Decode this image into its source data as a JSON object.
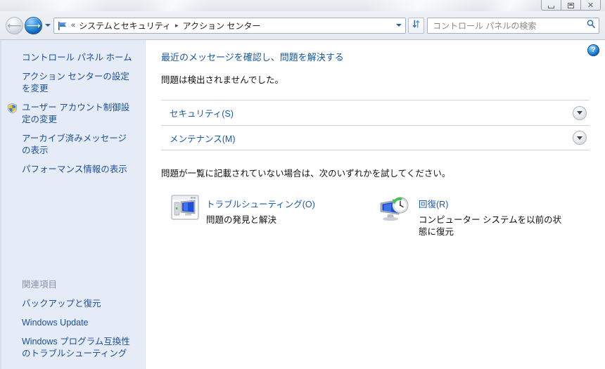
{
  "window": {
    "controls": {
      "minimize_label": "Minimize",
      "maximize_label": "Maximize",
      "close_label": "Close"
    }
  },
  "navbar": {
    "back_label": "戻る",
    "forward_label": "進む",
    "recent_pages_label": "最近表示したページ",
    "address": {
      "chevrons": "«",
      "breadcrumbs": [
        "システムとセキュリティ",
        "アクション センター"
      ],
      "separator": "▸"
    },
    "refresh_label": "最新の情報に更新",
    "search": {
      "placeholder": "コントロール パネルの検索",
      "value": ""
    }
  },
  "sidebar": {
    "items": [
      {
        "label": "コントロール パネル ホーム",
        "icon": ""
      },
      {
        "label": "アクション センターの設定を変更",
        "icon": ""
      },
      {
        "label": "ユーザー アカウント制御設定の変更",
        "icon": "shield-icon"
      },
      {
        "label": "アーカイブ済みメッセージの表示",
        "icon": ""
      },
      {
        "label": "パフォーマンス情報の表示",
        "icon": ""
      }
    ],
    "related": {
      "heading": "関連項目",
      "items": [
        {
          "label": "バックアップと復元"
        },
        {
          "label": "Windows Update"
        },
        {
          "label": "Windows プログラム互換性のトラブルシューティング"
        }
      ]
    }
  },
  "main": {
    "help_label": "?",
    "heading": "最近のメッセージを確認し、問題を解決する",
    "subtext": "問題は検出されませんでした。",
    "sections": [
      {
        "label": "セキュリティ(S)",
        "expand_icon": "chevron-down-icon"
      },
      {
        "label": "メンテナンス(M)",
        "expand_icon": "chevron-down-icon"
      }
    ],
    "try_text": "問題が一覧に記載されていない場合は、次のいずれかを試してください。",
    "actions": [
      {
        "icon": "troubleshooting-icon",
        "title": "トラブルシューティング(O)",
        "desc": "問題の発見と解決"
      },
      {
        "icon": "recovery-icon",
        "title": "回復(R)",
        "desc": "コンピューター システムを以前の状態に復元"
      }
    ]
  },
  "colors": {
    "link": "#1b5bab",
    "sidebar_bg": "#e5ecf8",
    "content_bg": "#ffffff",
    "accent_blue": "#1064b8"
  }
}
